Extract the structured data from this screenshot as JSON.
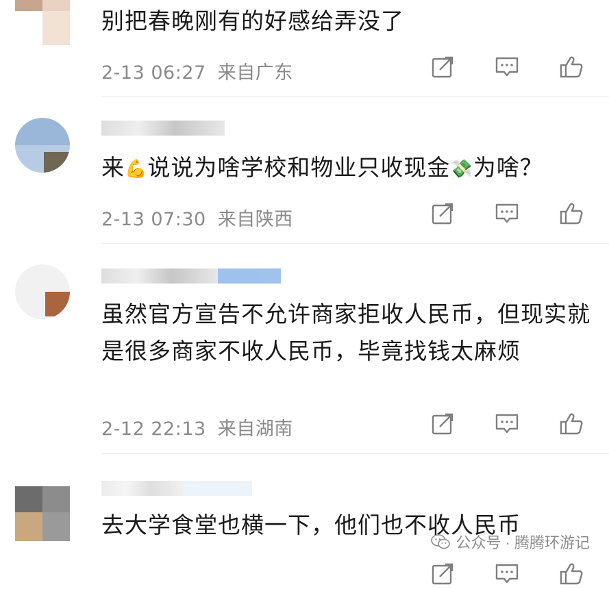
{
  "comments": [
    {
      "text": "别把春晚刚有的好感给弄没了",
      "time": "2-13 06:27",
      "location": "来自广东"
    },
    {
      "text_parts": [
        "来",
        "说说为啥学校和物业只收现金",
        "为啥？"
      ],
      "time": "2-13 07:30",
      "location": "来自陕西"
    },
    {
      "text": "虽然官方宣告不允许商家拒收人民币，但现实就是很多商家不收人民币，毕竟找钱太麻烦",
      "time": "2-12 22:13",
      "location": "来自湖南"
    },
    {
      "text": "去大学食堂也横一下，他们也不收人民币"
    }
  ],
  "icons": {
    "share": "share-icon",
    "comment": "comment-icon",
    "like": "thumbs-up-icon",
    "muscle": "flexed-biceps-emoji",
    "money": "money-with-wings-emoji"
  },
  "watermark": {
    "text": "公众号 · 腾腾环游记"
  },
  "colors": {
    "text": "#1a1a1a",
    "meta": "#8a8a8a",
    "icon": "#7f7f7f",
    "divider": "#ececec"
  }
}
